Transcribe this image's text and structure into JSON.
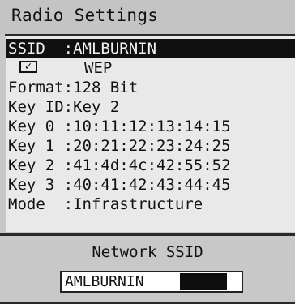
{
  "app": {
    "title": "Radio Settings"
  },
  "settings": [
    {
      "id": "ssid",
      "text": "SSID  :AMLBURNIN",
      "selected": true
    },
    {
      "id": "key-id",
      "text": "Key ID:Key 2"
    },
    {
      "id": "format",
      "text": "Format:128 Bit"
    },
    {
      "id": "key0",
      "text": "Key 0 :10:11:12:13:14:15"
    },
    {
      "id": "key1",
      "text": "Key 1 :20:21:22:23:24:25"
    },
    {
      "id": "key2",
      "text": "Key 2 :41:4d:4c:42:55:52"
    },
    {
      "id": "key3",
      "text": "Key 3 :40:41:42:43:44:45"
    },
    {
      "id": "mode",
      "text": "Mode  :Infrastructure"
    }
  ],
  "wep": {
    "label": "WEP",
    "checked": true,
    "check_glyph": "✓"
  },
  "ssid_editor": {
    "caption": "Network SSID",
    "value": "AMLBURNIN"
  },
  "colors": {
    "panel_bg": "#e9e9e9",
    "frame_bg": "#c7c7c7",
    "selected_bg": "#101010",
    "selected_fg": "#f2f2f2"
  }
}
